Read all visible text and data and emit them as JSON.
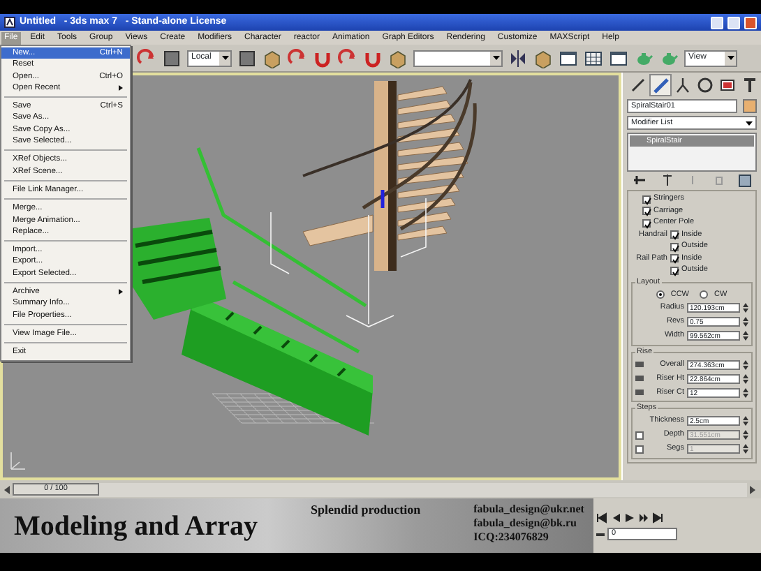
{
  "window": {
    "title": "Untitled   - 3ds max 7   - Stand-alone License"
  },
  "menu_bar": [
    {
      "label": "File",
      "selected": true
    },
    {
      "label": "Edit",
      "selected": false
    },
    {
      "label": "Tools",
      "selected": false
    },
    {
      "label": "Group",
      "selected": false
    },
    {
      "label": "Views",
      "selected": false
    },
    {
      "label": "Create",
      "selected": false
    },
    {
      "label": "Modifiers",
      "selected": false
    },
    {
      "label": "Character",
      "selected": false
    },
    {
      "label": "reactor",
      "selected": false
    },
    {
      "label": "Animation",
      "selected": false
    },
    {
      "label": "Graph Editors",
      "selected": false
    },
    {
      "label": "Rendering",
      "selected": false
    },
    {
      "label": "Customize",
      "selected": false
    },
    {
      "label": "MAXScript",
      "selected": false
    },
    {
      "label": "Help",
      "selected": false
    }
  ],
  "toolbar": {
    "reference_coordinate": "Local",
    "viewport_select": "View"
  },
  "file_menu": [
    {
      "kind": "item",
      "label": "New...",
      "shortcut": "Ctrl+N",
      "selected": true
    },
    {
      "kind": "item",
      "label": "Reset",
      "selected": false
    },
    {
      "kind": "item",
      "label": "Open...",
      "shortcut": "Ctrl+O",
      "selected": false
    },
    {
      "kind": "item",
      "label": "Open Recent",
      "submenu": true,
      "selected": false
    },
    {
      "kind": "separator"
    },
    {
      "kind": "item",
      "label": "Save",
      "shortcut": "Ctrl+S",
      "selected": false
    },
    {
      "kind": "item",
      "label": "Save As...",
      "selected": false
    },
    {
      "kind": "item",
      "label": "Save Copy As...",
      "selected": false
    },
    {
      "kind": "item",
      "label": "Save Selected...",
      "selected": false
    },
    {
      "kind": "separator"
    },
    {
      "kind": "item",
      "label": "XRef Objects...",
      "selected": false
    },
    {
      "kind": "item",
      "label": "XRef Scene...",
      "selected": false
    },
    {
      "kind": "separator"
    },
    {
      "kind": "item",
      "label": "File Link Manager...",
      "selected": false
    },
    {
      "kind": "separator"
    },
    {
      "kind": "item",
      "label": "Merge...",
      "selected": false
    },
    {
      "kind": "item",
      "label": "Merge Animation...",
      "selected": false
    },
    {
      "kind": "item",
      "label": "Replace...",
      "selected": false
    },
    {
      "kind": "separator"
    },
    {
      "kind": "item",
      "label": "Import...",
      "selected": false
    },
    {
      "kind": "item",
      "label": "Export...",
      "selected": false
    },
    {
      "kind": "item",
      "label": "Export Selected...",
      "selected": false
    },
    {
      "kind": "separator"
    },
    {
      "kind": "item",
      "label": "Archive",
      "submenu": true,
      "selected": false
    },
    {
      "kind": "item",
      "label": "Summary Info...",
      "selected": false
    },
    {
      "kind": "item",
      "label": "File Properties...",
      "selected": false
    },
    {
      "kind": "separator"
    },
    {
      "kind": "item",
      "label": "View Image File...",
      "selected": false
    },
    {
      "kind": "separator"
    },
    {
      "kind": "item",
      "label": "Exit",
      "selected": false
    }
  ],
  "command_panel": {
    "tabs": [
      {
        "selected": false
      },
      {
        "selected": true
      },
      {
        "selected": false
      },
      {
        "selected": false
      },
      {
        "selected": false
      },
      {
        "selected": false
      }
    ],
    "object_name": "SpiralStair01",
    "modifier_list": "Modifier List",
    "stack": [
      {
        "label": "SpiralStair",
        "selected": true
      }
    ],
    "generate": [
      {
        "label": "Stringers",
        "checked": true
      },
      {
        "label": "Carriage",
        "checked": true
      },
      {
        "label": "Center Pole",
        "checked": true
      },
      {
        "group": "Handrail",
        "label": "Inside",
        "checked": true
      },
      {
        "label": "Outside",
        "checked": true
      },
      {
        "group": "Rail Path",
        "label": "Inside",
        "checked": true
      },
      {
        "label": "Outside",
        "checked": true
      }
    ],
    "layout": {
      "title": "Layout",
      "direction": [
        {
          "label": "CCW",
          "selected": true
        },
        {
          "label": "CW",
          "selected": false
        }
      ],
      "spinners": [
        {
          "label": "Radius",
          "value": "120.193cm"
        },
        {
          "label": "Revs",
          "value": "0.75"
        },
        {
          "label": "Width",
          "value": "99.562cm"
        }
      ]
    },
    "rise": {
      "title": "Rise",
      "spinners": [
        {
          "kind": "pinned",
          "label": "Overall",
          "value": "274.363cm"
        },
        {
          "kind": "pinned",
          "label": "Riser Ht",
          "value": "22.864cm"
        },
        {
          "kind": "pinned",
          "label": "Riser Ct",
          "value": "12"
        }
      ]
    },
    "steps": {
      "title": "Steps",
      "spinners": [
        {
          "label": "Thickness",
          "value": "2.5cm"
        },
        {
          "kind": "optional",
          "label": "Depth",
          "value": "31.551cm",
          "checked": false,
          "disabled": true
        },
        {
          "kind": "optional",
          "label": "Segs",
          "value": "1",
          "checked": false,
          "disabled": true
        }
      ]
    }
  },
  "timeline": {
    "frame": "0 / 100",
    "level": 0
  },
  "caption": {
    "title": "Modeling and Array",
    "credit": "Splendid production",
    "contacts": [
      "fabula_design@ukr.net",
      "fabula_design@bk.ru",
      "ICQ:234076829"
    ]
  },
  "playback": {
    "frame": "0"
  }
}
